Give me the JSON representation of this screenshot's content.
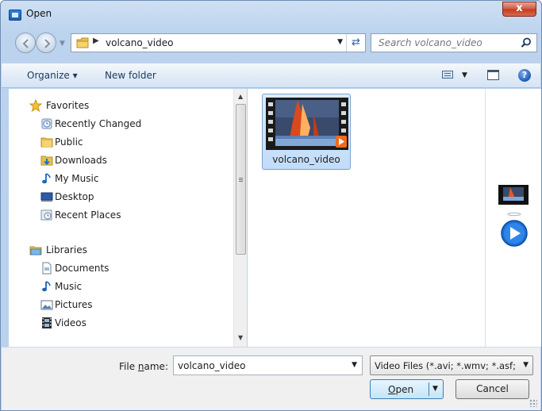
{
  "window": {
    "title": "Open",
    "close_glyph": "x"
  },
  "nav": {
    "address_path": "volcano_video",
    "search_placeholder": "Search volcano_video"
  },
  "toolbar": {
    "organize_label": "Organize ▾",
    "new_folder_label": "New folder"
  },
  "sidebar": {
    "favorites_label": "Favorites",
    "favorites": [
      {
        "label": "Recently Changed",
        "icon": "recent-changed-icon"
      },
      {
        "label": "Public",
        "icon": "folder-icon"
      },
      {
        "label": "Downloads",
        "icon": "downloads-icon"
      },
      {
        "label": "My Music",
        "icon": "music-note-icon"
      },
      {
        "label": "Desktop",
        "icon": "desktop-icon"
      },
      {
        "label": "Recent Places",
        "icon": "recent-places-icon"
      }
    ],
    "libraries_label": "Libraries",
    "libraries": [
      {
        "label": "Documents",
        "icon": "documents-icon"
      },
      {
        "label": "Music",
        "icon": "music-note-icon"
      },
      {
        "label": "Pictures",
        "icon": "pictures-icon"
      },
      {
        "label": "Videos",
        "icon": "film-icon"
      }
    ]
  },
  "files": [
    {
      "name": "volcano_video",
      "type": "video"
    }
  ],
  "footer": {
    "file_name_label_pre": "File ",
    "file_name_label_ul": "n",
    "file_name_label_post": "ame:",
    "file_name_value": "volcano_video",
    "file_type_value": "Video Files (*.avi; *.wmv; *.asf; *",
    "open_label_ul": "O",
    "open_label_rest": "pen",
    "cancel_label": "Cancel"
  },
  "colors": {
    "accent": "#2c6fc1",
    "selection": "#c1dcfa",
    "close": "#c23a1e"
  }
}
